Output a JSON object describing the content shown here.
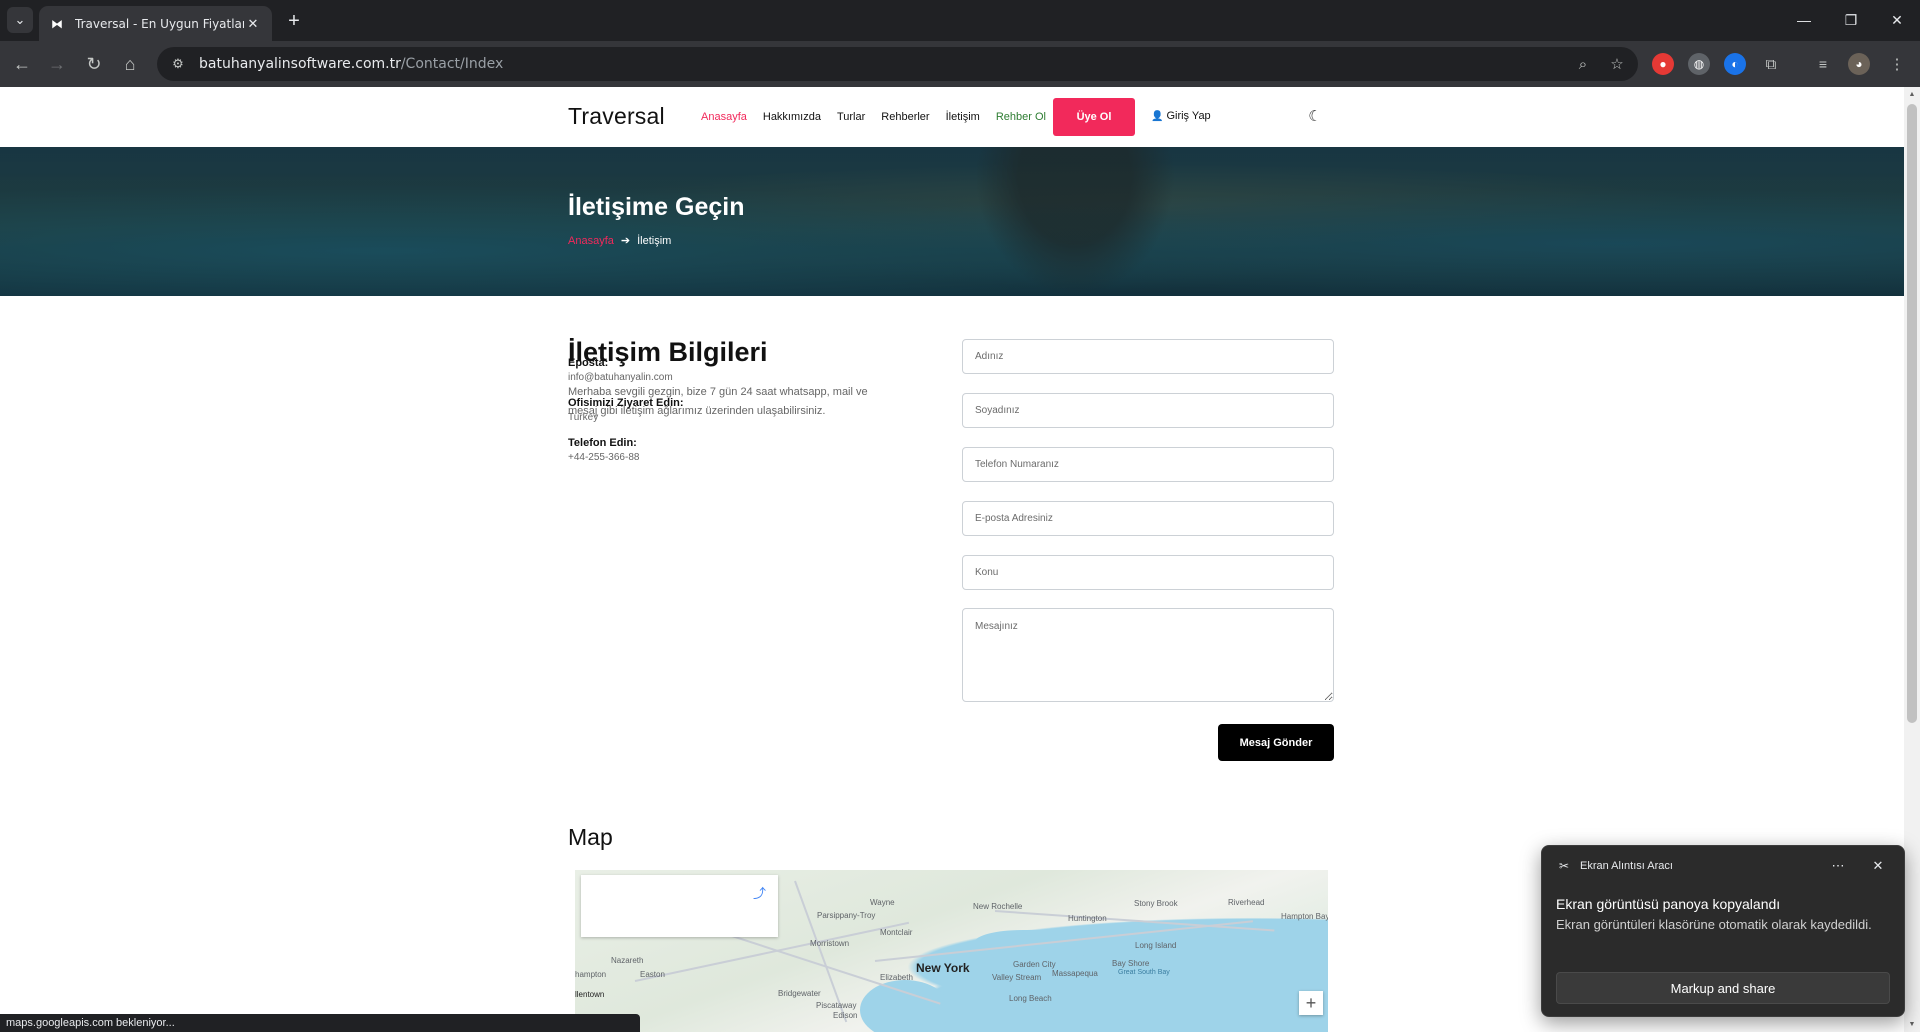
{
  "browser": {
    "tab_title": "Traversal - En Uygun Fiyatlara G",
    "url_host": "batuhanyalinsoftware.com.tr",
    "url_path": "/Contact/Index",
    "status_text": "maps.googleapis.com bekleniyor..."
  },
  "nav": {
    "brand": "Traversal",
    "links": [
      "Anasayfa",
      "Hakkımızda",
      "Turlar",
      "Rehberler",
      "İletişim",
      "Rehber Ol"
    ],
    "signup": "Üye Ol",
    "login": "Giriş Yap"
  },
  "hero": {
    "title": "İletişime Geçin",
    "breadcrumb_home": "Anasayfa",
    "breadcrumb_current": "İletişim"
  },
  "contact_info": {
    "title": "İletişim Bilgileri",
    "description": "Merhaba sevgili gezgin, bize 7 gün 24 saat whatsapp, mail ve mesaj gibi iletişim ağlarımız üzerinden ulaşabilirsiniz.",
    "email_label": "Eposta:",
    "email_value": "info@batuhanyalin.com",
    "office_label": "Ofisimizi Ziyaret Edin:",
    "office_value": "Turkey",
    "phone_label": "Telefon Edin:",
    "phone_value": "+44-255-366-88"
  },
  "form": {
    "name_placeholder": "Adınız",
    "surname_placeholder": "Soyadınız",
    "phone_placeholder": "Telefon Numaranız",
    "email_placeholder": "E-posta Adresiniz",
    "subject_placeholder": "Konu",
    "message_placeholder": "Mesajınız",
    "submit": "Mesaj Gönder"
  },
  "map": {
    "title": "Map",
    "labels": {
      "new_york": "New York",
      "wayne": "Wayne",
      "parsippany": "Parsippany-Troy",
      "morristown": "Morristown",
      "montclair": "Montclair",
      "new_rochelle": "New Rochelle",
      "huntington": "Huntington",
      "stony_brook": "Stony Brook",
      "riverhead": "Riverhead",
      "hampton_bays": "Hampton Bay",
      "long_island": "Long Island",
      "garden_city": "Garden City",
      "valley_stream": "Valley Stream",
      "massapequa": "Massapequa",
      "bay_shore": "Bay Shore",
      "great_south_bay": "Great South Bay",
      "elizabeth": "Elizabeth",
      "long_beach": "Long Beach",
      "nazareth": "Nazareth",
      "easton": "Easton",
      "hampton": "hampton",
      "allentown": "llentown",
      "bridgewater": "Bridgewater",
      "piscataway": "Piscataway",
      "edison": "Edison"
    },
    "zoom_in": "+"
  },
  "toast": {
    "app": "Ekran Alıntısı Aracı",
    "title": "Ekran görüntüsü panoya kopyalandı",
    "body": "Ekran görüntüleri klasörüne otomatik olarak kaydedildi.",
    "button": "Markup and share"
  }
}
